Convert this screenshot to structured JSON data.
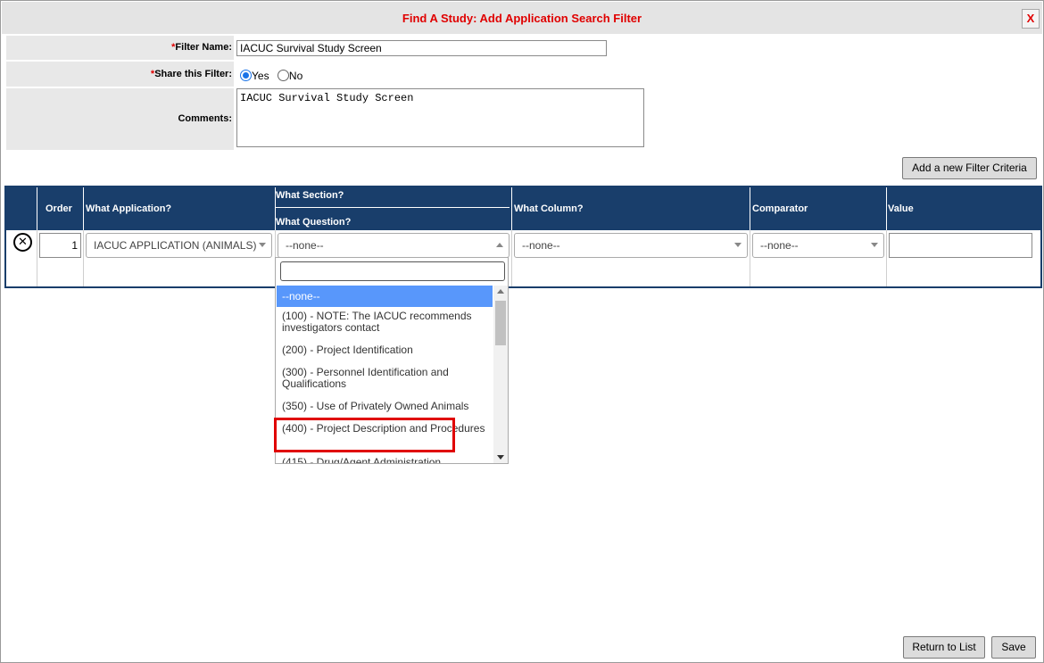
{
  "dialog": {
    "title": "Find A Study: Add Application Search Filter",
    "close_label": "X"
  },
  "form": {
    "filter_name_label": "Filter Name:",
    "filter_name_value": "IACUC Survival Study Screen",
    "share_label": "Share this Filter:",
    "share_yes": "Yes",
    "share_no": "No",
    "share_selected": "Yes",
    "comments_label": "Comments:",
    "comments_value": "IACUC Survival Study Screen",
    "required_marker": "*"
  },
  "buttons": {
    "add_criteria": "Add a new Filter Criteria",
    "return_to_list": "Return to List",
    "save": "Save"
  },
  "grid": {
    "headers": {
      "order": "Order",
      "application": "What Application?",
      "section": "What Section?",
      "question": "What Question?",
      "column": "What Column?",
      "comparator": "Comparator",
      "value": "Value"
    },
    "row": {
      "remove_icon": "circle-x-icon",
      "order": "1",
      "application": "IACUC APPLICATION (ANIMALS)",
      "question": "--none--",
      "column": "--none--",
      "comparator": "--none--",
      "value": ""
    }
  },
  "dropdown": {
    "search_value": "",
    "options": [
      "--none--",
      "(100) - NOTE: The IACUC recommends investigators contact",
      "(200) - Project Identification",
      "(300) - Personnel Identification and Qualifications",
      "(350) - Use of Privately Owned Animals",
      "(400) - Project Description and Procedures",
      "(415) - Drug/Agent Administration"
    ],
    "active_option": "--none--",
    "highlighted_option": "(400) - Project Description and Procedures"
  },
  "colors": {
    "title_red": "#e00000",
    "header_navy": "#193e6b",
    "active_option_blue": "#5897fb"
  }
}
